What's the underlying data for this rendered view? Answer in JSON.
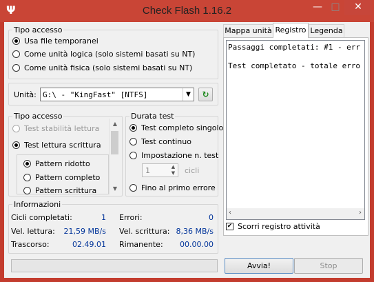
{
  "window": {
    "title": "Check Flash 1.16.2",
    "app_icon": "usb-icon"
  },
  "access_type_top": {
    "legend": "Tipo accesso",
    "options": [
      "Usa file temporanei",
      "Come unità logica (solo sistemi basati su NT)",
      "Come unità fisica (solo sistemi basati su NT)"
    ],
    "selected": 0
  },
  "drive": {
    "label": "Unità:",
    "value": "G:\\ - \"KingFast\" [NTFS]"
  },
  "access_type": {
    "legend": "Tipo accesso",
    "options": [
      "Test stabilità lettura",
      "Test lettura scrittura"
    ],
    "sub_options": [
      "Pattern ridotto",
      "Pattern completo",
      "Pattern scrittura"
    ]
  },
  "duration": {
    "legend": "Durata test",
    "options": [
      "Test completo singolo",
      "Test continuo",
      "Impostazione n. test"
    ],
    "cycles_value": "1",
    "cycles_unit": "cicli",
    "until_error": "Fino al primo errore"
  },
  "info": {
    "legend": "Informazioni",
    "cycles_label": "Cicli completati:",
    "cycles": "1",
    "errors_label": "Errori:",
    "errors": "0",
    "read_label": "Vel. lettura:",
    "read": "21,59 MB/s",
    "write_label": "Vel. scrittura:",
    "write": "8,36 MB/s",
    "elapsed_label": "Trascorso:",
    "elapsed": "02.49.01",
    "remaining_label": "Rimanente:",
    "remaining": "00.00.00"
  },
  "tabs": [
    "Mappa unità",
    "Registro",
    "Legenda"
  ],
  "log": {
    "lines": [
      "Passaggi completati: #1 - err",
      "",
      "Test completato - totale erro"
    ],
    "scroll_label": "Scorri registro attività",
    "scroll_checked": true
  },
  "buttons": {
    "start": "Avvia!",
    "stop": "Stop"
  }
}
